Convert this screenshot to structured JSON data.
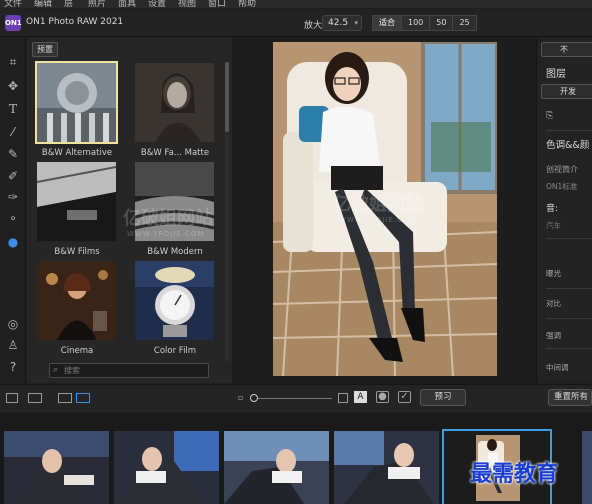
{
  "menu": [
    "文件",
    "编辑",
    "层",
    "照片",
    "面具",
    "设置",
    "视图",
    "窗口",
    "帮助"
  ],
  "app": {
    "logo_text": "ON1",
    "title": "ON1 Photo RAW 2021"
  },
  "zoom": {
    "label": "放大",
    "value": "42.5",
    "options": [
      "适合",
      "100",
      "50",
      "25"
    ]
  },
  "browser": {
    "preset_button": "预置",
    "search_placeholder": "搜索",
    "presets": [
      {
        "label": "B&W Alternative"
      },
      {
        "label": "B&W Fa... Matte"
      },
      {
        "label": "B&W Films"
      },
      {
        "label": "B&W Modern"
      },
      {
        "label": "Cinema"
      },
      {
        "label": "Color Film"
      }
    ]
  },
  "watermark": {
    "text1": "亿破姐网站",
    "text2": "WWW.YPOJIE.COM"
  },
  "bottom": {
    "preview_label": "预习",
    "reset_label": "重置所有"
  },
  "right_panel": {
    "top_button": "不",
    "layers_label": "图层",
    "develop_button": "开发",
    "tone_label": "色调&&颜",
    "adjust_label": "创视筒介",
    "on1_label": "ON1标准",
    "tone_section": "音:",
    "auto_label": "汽车",
    "exposure": "曝光",
    "contrast": "对比",
    "highlights": "强调",
    "midtones": "中间调"
  },
  "brand": "最需教育",
  "colors": {
    "accent_blue": "#3c8de8",
    "selected_preset": "#f0e29a",
    "filmstrip_selected": "#3aa0e0"
  }
}
